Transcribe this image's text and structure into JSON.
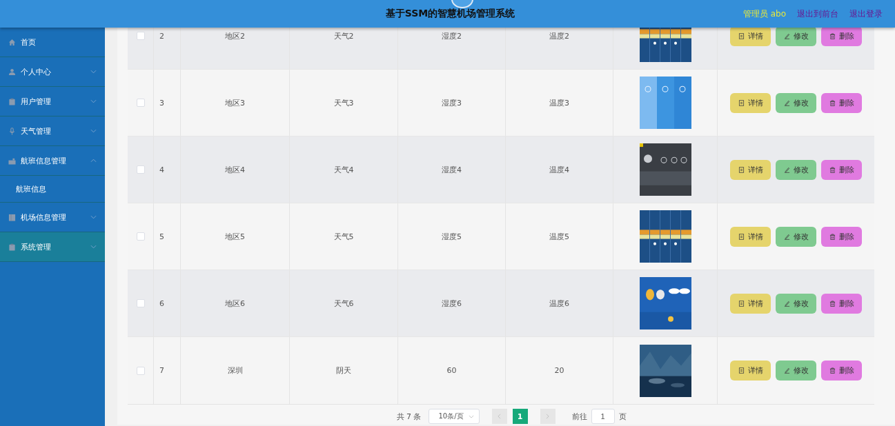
{
  "header": {
    "title": "基于SSM的智慧机场管理系统",
    "user": "管理员 abo",
    "links": [
      "退出到前台",
      "退出登录"
    ]
  },
  "sidebar": {
    "items": [
      {
        "label": "首页",
        "hovered": false
      },
      {
        "label": "个人中心",
        "expanded": false,
        "hovered": false
      },
      {
        "label": "用户管理",
        "expanded": false,
        "hovered": false
      },
      {
        "label": "天气管理",
        "expanded": false,
        "hovered": false
      },
      {
        "label": "航班信息管理",
        "expanded": true,
        "hovered": false,
        "children": [
          {
            "label": "航班信息"
          }
        ]
      },
      {
        "label": "机场信息管理",
        "expanded": false,
        "hovered": false
      },
      {
        "label": "系统管理",
        "expanded": false,
        "hovered": true
      }
    ]
  },
  "table": {
    "rows": [
      {
        "checked": false,
        "cells": [
          "2",
          "地区2",
          "天气2",
          "湿度2",
          "温度2"
        ],
        "actions": [
          {
            "label": "详情",
            "kind": "detail"
          },
          {
            "label": "修改",
            "kind": "edit"
          },
          {
            "label": "删除",
            "kind": "delete"
          }
        ]
      },
      {
        "checked": false,
        "cells": [
          "3",
          "地区3",
          "天气3",
          "湿度3",
          "温度3"
        ],
        "actions": [
          {
            "label": "详情",
            "kind": "detail"
          },
          {
            "label": "修改",
            "kind": "edit"
          },
          {
            "label": "删除",
            "kind": "delete"
          }
        ]
      },
      {
        "checked": false,
        "cells": [
          "4",
          "地区4",
          "天气4",
          "湿度4",
          "温度4"
        ],
        "actions": [
          {
            "label": "详情",
            "kind": "detail"
          },
          {
            "label": "修改",
            "kind": "edit"
          },
          {
            "label": "删除",
            "kind": "delete"
          }
        ]
      },
      {
        "checked": false,
        "cells": [
          "5",
          "地区5",
          "天气5",
          "湿度5",
          "温度5"
        ],
        "actions": [
          {
            "label": "详情",
            "kind": "detail"
          },
          {
            "label": "修改",
            "kind": "edit"
          },
          {
            "label": "删除",
            "kind": "delete"
          }
        ]
      },
      {
        "checked": false,
        "cells": [
          "6",
          "地区6",
          "天气6",
          "湿度6",
          "温度6"
        ],
        "actions": [
          {
            "label": "详情",
            "kind": "detail"
          },
          {
            "label": "修改",
            "kind": "edit"
          },
          {
            "label": "删除",
            "kind": "delete"
          }
        ]
      },
      {
        "checked": false,
        "cells": [
          "7",
          "深圳",
          "阴天",
          "60",
          "20"
        ],
        "actions": [
          {
            "label": "详情",
            "kind": "detail"
          },
          {
            "label": "修改",
            "kind": "edit"
          },
          {
            "label": "删除",
            "kind": "delete"
          }
        ]
      }
    ]
  },
  "pagination": {
    "total": "共 7 条",
    "page_size": "10条/页",
    "pages": [
      {
        "label": "1",
        "selected": true
      }
    ],
    "goto_label": "前往",
    "goto_value": "1",
    "goto_suffix": "页"
  }
}
